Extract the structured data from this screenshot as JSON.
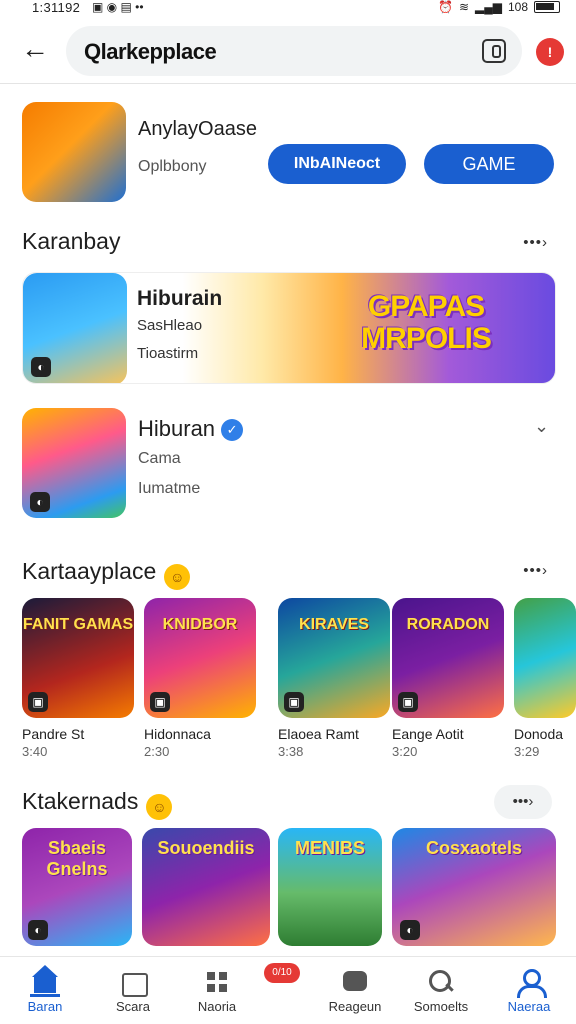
{
  "status_bar": {
    "time": "1:31192",
    "battery": "108"
  },
  "search": {
    "query": "Qlarkepplace"
  },
  "header": {
    "notification_badge": "!"
  },
  "featured_app": {
    "title": "AnylayOaase",
    "subtitle": "Oplbbony",
    "button_primary": "INbAINeoct",
    "button_game": "GAME"
  },
  "section_1": {
    "title": "Karanbay",
    "more": "•••›"
  },
  "banner": {
    "title": "Hiburain",
    "sub1": "SasHleao",
    "sub2": "Tioastirm",
    "logo_line1": "GPAPAS",
    "logo_line2": "MRPOLIS"
  },
  "app_row_2": {
    "title": "Hiburan",
    "sub1": "Cama",
    "sub2": "Iumatme"
  },
  "section_2": {
    "title": "Kartaayplace",
    "more": "•••›",
    "games": [
      {
        "name": "Pandre St",
        "meta": "3:40",
        "art_text": "FANIT GAMAS"
      },
      {
        "name": "Hidonnaca",
        "meta": "2:30",
        "art_text": "KNIDBOR"
      },
      {
        "name": "Elaoea Ramt",
        "meta": "3:38",
        "art_text": "KIRAVES"
      },
      {
        "name": "Eange Aotit",
        "meta": "3:20",
        "art_text": "RORADON"
      },
      {
        "name": "Donoda",
        "meta": "3:29",
        "art_text": ""
      }
    ]
  },
  "section_3": {
    "title": "Ktakernads",
    "more": "•••›",
    "games": [
      {
        "art_text": "Sbaeis Gnelns"
      },
      {
        "art_text": "Souoendiis"
      },
      {
        "art_text": "MENIBS"
      },
      {
        "art_text": "Cosxaotels"
      }
    ]
  },
  "bottom_nav": {
    "badge": "0/10",
    "items": [
      {
        "label": "Baran"
      },
      {
        "label": "Scara"
      },
      {
        "label": "Naoria"
      },
      {
        "label": "Reageun"
      },
      {
        "label": "Somoelts"
      },
      {
        "label": "Naeraa"
      }
    ]
  },
  "colors": {
    "accent": "#1a5fd0",
    "badge": "#e53935"
  }
}
